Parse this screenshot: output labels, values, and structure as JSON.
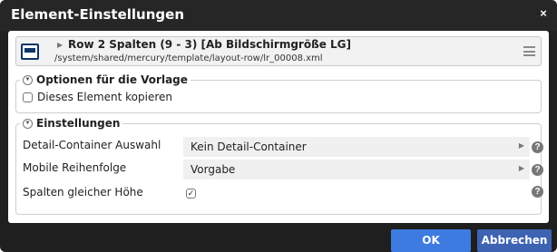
{
  "dialog": {
    "title": "Element-Einstellungen",
    "close_label": "×"
  },
  "element": {
    "icon": "row-layout-icon",
    "caret": "▶",
    "title": "Row 2 Spalten (9 - 3) [Ab Bildschirmgröße LG]",
    "path": "/system/shared/mercury/template/layout-row/lr_00008.xml",
    "menu_icon": "hamburger-menu-icon"
  },
  "template_options": {
    "legend": "Optionen für die Vorlage",
    "copy_label": "Dieses Element kopieren",
    "copy_checked": false
  },
  "settings": {
    "legend": "Einstellungen",
    "rows": [
      {
        "label": "Detail-Container Auswahl",
        "value": "Kein Detail-Container"
      },
      {
        "label": "Mobile Reihenfolge",
        "value": "Vorgabe"
      },
      {
        "label": "Spalten gleicher Höhe",
        "checked": true
      }
    ]
  },
  "buttons": {
    "ok": "OK",
    "cancel": "Abbrechen"
  },
  "colors": {
    "titlebar": "#262626",
    "ok_button": "#3d7be0",
    "cancel_button": "#3f63b3",
    "icon_blue": "#0e3566"
  }
}
